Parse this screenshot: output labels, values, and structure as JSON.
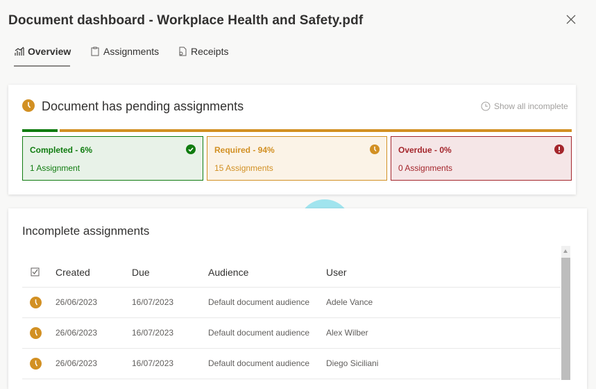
{
  "header": {
    "title": "Document dashboard - Workplace Health and Safety.pdf"
  },
  "tabs": [
    {
      "label": "Overview",
      "icon": "chart-icon",
      "active": true
    },
    {
      "label": "Assignments",
      "icon": "clipboard-icon"
    },
    {
      "label": "Receipts",
      "icon": "receipt-icon"
    }
  ],
  "summary": {
    "title": "Document has pending assignments",
    "show_all_label": "Show all incomplete",
    "progress": {
      "completed_percent": 6,
      "required_percent": 94,
      "overdue_percent": 0
    },
    "boxes": [
      {
        "title": "Completed - 6%",
        "subtitle": "1 Assignment",
        "icon": "check-circle-icon"
      },
      {
        "title": "Required - 94%",
        "subtitle": "15 Assignments",
        "icon": "clock-icon"
      },
      {
        "title": "Overdue - 0%",
        "subtitle": "0 Assignments",
        "icon": "exclamation-circle-icon"
      }
    ],
    "colors": {
      "completed": "#107c10",
      "required": "#d29023",
      "overdue": "#a4262c"
    }
  },
  "incomplete": {
    "title": "Incomplete assignments",
    "columns": [
      "Created",
      "Due",
      "Audience",
      "User"
    ],
    "rows": [
      {
        "created": "26/06/2023",
        "due": "16/07/2023",
        "audience": "Default document audience",
        "user": "Adele Vance"
      },
      {
        "created": "26/06/2023",
        "due": "16/07/2023",
        "audience": "Default document audience",
        "user": "Alex Wilber"
      },
      {
        "created": "26/06/2023",
        "due": "16/07/2023",
        "audience": "Default document audience",
        "user": "Diego Siciliani"
      }
    ]
  }
}
